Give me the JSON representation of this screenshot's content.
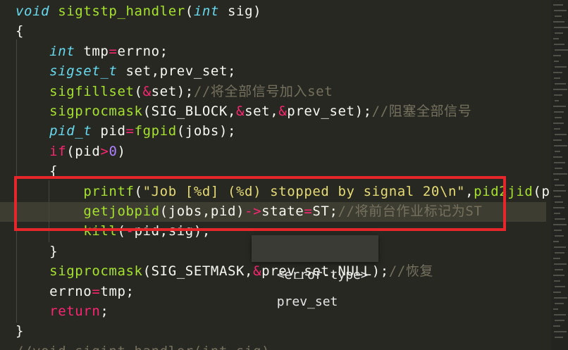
{
  "colors": {
    "background": "#272822",
    "keyword": "#f92672",
    "type": "#66d9ef",
    "function": "#a6e22e",
    "number": "#ae81ff",
    "string": "#e6db74",
    "comment": "#75715e",
    "highlight_box": "#e5262b"
  },
  "code": {
    "lines": [
      [
        {
          "t": "void ",
          "c": "ty"
        },
        {
          "t": "sigtstp_handler",
          "c": "fn"
        },
        {
          "t": "(",
          "c": ""
        },
        {
          "t": "int ",
          "c": "ty"
        },
        {
          "t": "sig",
          "c": ""
        },
        {
          "t": ")",
          "c": ""
        }
      ],
      [
        {
          "t": "{",
          "c": ""
        }
      ],
      [
        {
          "t": "    ",
          "c": ""
        },
        {
          "t": "int ",
          "c": "ty"
        },
        {
          "t": "tmp",
          "c": ""
        },
        {
          "t": "=",
          "c": "kw"
        },
        {
          "t": "errno;",
          "c": ""
        }
      ],
      [
        {
          "t": "    ",
          "c": ""
        },
        {
          "t": "sigset_t ",
          "c": "ty"
        },
        {
          "t": "set,prev_set;",
          "c": ""
        }
      ],
      [
        {
          "t": "    ",
          "c": ""
        },
        {
          "t": "sigfillset",
          "c": "fn"
        },
        {
          "t": "(",
          "c": ""
        },
        {
          "t": "&",
          "c": "kw"
        },
        {
          "t": "set);",
          "c": ""
        },
        {
          "t": "//将全部信号加入set",
          "c": "cm"
        }
      ],
      [
        {
          "t": "    ",
          "c": ""
        },
        {
          "t": "sigprocmask",
          "c": "fn"
        },
        {
          "t": "(SIG_BLOCK,",
          "c": ""
        },
        {
          "t": "&",
          "c": "kw"
        },
        {
          "t": "set,",
          "c": ""
        },
        {
          "t": "&",
          "c": "kw"
        },
        {
          "t": "prev_set);",
          "c": ""
        },
        {
          "t": "//阻塞全部信号",
          "c": "cm"
        }
      ],
      [
        {
          "t": "    ",
          "c": ""
        },
        {
          "t": "pid_t ",
          "c": "ty"
        },
        {
          "t": "pid",
          "c": ""
        },
        {
          "t": "=",
          "c": "kw"
        },
        {
          "t": "fgpid",
          "c": "fn"
        },
        {
          "t": "(jobs);",
          "c": ""
        }
      ],
      [
        {
          "t": "    ",
          "c": ""
        },
        {
          "t": "if",
          "c": "kw"
        },
        {
          "t": "(pid",
          "c": ""
        },
        {
          "t": ">",
          "c": "kw"
        },
        {
          "t": "0",
          "c": "num"
        },
        {
          "t": ")",
          "c": ""
        }
      ],
      [
        {
          "t": "    {",
          "c": ""
        }
      ],
      [
        {
          "t": "        ",
          "c": ""
        },
        {
          "t": "printf",
          "c": "fn"
        },
        {
          "t": "(",
          "c": ""
        },
        {
          "t": "\"Job [%d] (%d) stopped by signal 20\\n\"",
          "c": "str"
        },
        {
          "t": ",",
          "c": ""
        },
        {
          "t": "pid2jid",
          "c": "fn"
        },
        {
          "t": "(pid",
          "c": ""
        }
      ],
      [
        {
          "t": "        ",
          "c": ""
        },
        {
          "t": "getjobpid",
          "c": "fn"
        },
        {
          "t": "(jobs,pid)",
          "c": ""
        },
        {
          "t": "->",
          "c": "kw"
        },
        {
          "t": "state",
          "c": ""
        },
        {
          "t": "=",
          "c": "kw"
        },
        {
          "t": "ST;",
          "c": ""
        },
        {
          "t": "//将前台作业标记为ST",
          "c": "cm"
        }
      ],
      [
        {
          "t": "        ",
          "c": ""
        },
        {
          "t": "kill",
          "c": "fn"
        },
        {
          "t": "(",
          "c": ""
        },
        {
          "t": "-",
          "c": "kw"
        },
        {
          "t": "pid,sig);",
          "c": ""
        }
      ],
      [
        {
          "t": "    }",
          "c": ""
        }
      ],
      [
        {
          "t": "    ",
          "c": ""
        },
        {
          "t": "sigprocmask",
          "c": "fn"
        },
        {
          "t": "(SIG_SETMASK,",
          "c": ""
        },
        {
          "t": "&",
          "c": "kw"
        },
        {
          "t": "prev_set,NULL);",
          "c": ""
        },
        {
          "t": "//恢复",
          "c": "cm"
        }
      ],
      [
        {
          "t": "    ",
          "c": ""
        },
        {
          "t": "errno",
          "c": ""
        },
        {
          "t": "=",
          "c": "kw"
        },
        {
          "t": "tmp;",
          "c": ""
        }
      ],
      [
        {
          "t": "    ",
          "c": ""
        },
        {
          "t": "return",
          "c": "kw"
        },
        {
          "t": ";",
          "c": ""
        }
      ],
      [
        {
          "t": "}",
          "c": ""
        }
      ],
      [
        {
          "t": "//void sigint_handler(int sig)",
          "c": "cm"
        }
      ]
    ]
  },
  "tooltip": {
    "type_tag": "<error-type>",
    "text": "prev_set"
  }
}
